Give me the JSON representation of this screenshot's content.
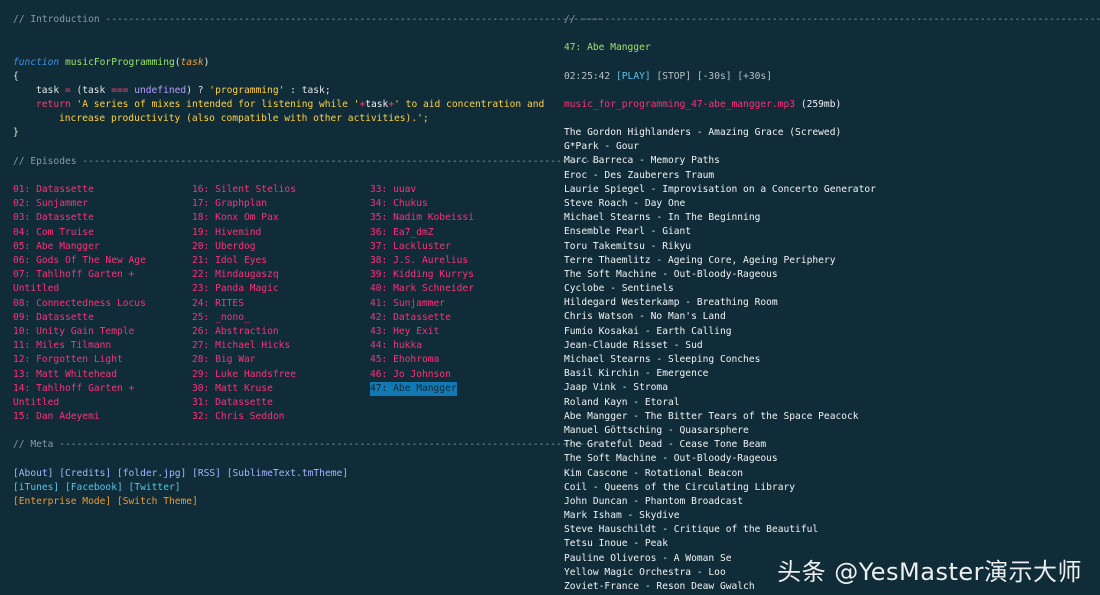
{
  "intro": {
    "header": "// Introduction --------------------------------------------------------------------------------------",
    "kw_function": "function",
    "fn_name": "musicForProgramming",
    "paren_open": "(",
    "param": "task",
    "paren_close": ")",
    "brace_open": "{",
    "l3_a": "task",
    "l3_b": " = ",
    "l3_c": "(task ",
    "l3_d": "===",
    "l3_e": " ",
    "l3_f": "undefined",
    "l3_g": ") ? ",
    "l3_h": "'programming'",
    "l3_i": " : task;",
    "l4_kw": "return",
    "l4_str1": " 'A series of mixes intended for listening while '",
    "l4_op1": "+",
    "l4_task": "task",
    "l4_op2": "+",
    "l4_str2": "' to aid concentration and",
    "l5": "increase productivity (also compatible with other activities).';",
    "brace_close": "}"
  },
  "episodes": {
    "header": "// Episodes ------------------------------------------------------------------------------------------",
    "col1": [
      "01: Datassette",
      "02: Sunjammer",
      "03: Datassette",
      "04: Com Truise",
      "05: Abe Mangger",
      "06: Gods Of The New Age",
      "07: Tahlhoff Garten +",
      "Untitled",
      "08: Connectedness Locus",
      "09: Datassette",
      "10: Unity Gain Temple",
      "11: Miles Tilmann",
      "12: Forgotten Light",
      "13: Matt Whitehead",
      "14: Tahlhoff Garten +",
      "Untitled",
      "15: Dan Adeyemi"
    ],
    "col2": [
      "16: Silent Stelios",
      "17: Graphplan",
      "18: Konx Om Pax",
      "19: Hivemind",
      "20: Uberdog",
      "21: Idol Eyes",
      "22: Mindaugaszq",
      "23: Panda Magic",
      "24: RITES",
      "25: _nono_",
      "26: Abstraction",
      "27: Michael Hicks",
      "28: Big War",
      "29: Luke Handsfree",
      "30: Matt Kruse",
      "31: Datassette",
      "32: Chris Seddon"
    ],
    "col3": [
      "33: uuav",
      "34: Chukus",
      "35: Nadim Kobeissi",
      "36: Ea7_dmZ",
      "37: Lackluster",
      "38: J.S. Aurelius",
      "39: Kidding Kurrys",
      "40: Mark Schneider",
      "41: Sunjammer",
      "42: Datassette",
      "43: Hey Exit",
      "44: hukka",
      "45: Ehohroma",
      "46: Jo Johnson",
      "47: Abe Mangger"
    ]
  },
  "meta": {
    "header": "// Meta ----------------------------------------------------------------------------------------------",
    "about": "[About]",
    "credits": "[Credits]",
    "folder": "[folder.jpg]",
    "rss": "[RSS]",
    "sublime": "[SublimeText.tmTheme]",
    "itunes": "[iTunes]",
    "facebook": "[Facebook]",
    "twitter": "[Twitter]",
    "enterprise": "[Enterprise Mode]",
    "switch": "[Switch Theme]"
  },
  "player": {
    "header": "// --------------------------------------------------------------------------------------------",
    "title": "47: Abe Mangger",
    "time": "02:25:42",
    "play": "[PLAY]",
    "stop": "[STOP]",
    "back": "[-30s]",
    "fwd": "[+30s]",
    "file": "music_for_programming_47-abe_mangger.mp3",
    "size": "(259mb)"
  },
  "tracklist": [
    "The Gordon Highlanders - Amazing Grace (Screwed)",
    "G*Park - Gour",
    "Marc Barreca - Memory Paths",
    "Eroc - Des Zauberers Traum",
    "Laurie Spiegel - Improvisation on a Concerto Generator",
    "Steve Roach - Day One",
    "Michael Stearns - In The Beginning",
    "Ensemble Pearl - Giant",
    "Toru Takemitsu - Rikyu",
    "Terre Thaemlitz - Ageing Core, Ageing Periphery",
    "The Soft Machine - Out-Bloody-Rageous",
    "Cyclobe - Sentinels",
    "Hildegard Westerkamp - Breathing Room",
    "Chris Watson - No Man's Land",
    "Fumio Kosakai - Earth Calling",
    "Jean-Claude Risset - Sud",
    "Michael Stearns - Sleeping Conches",
    "Basil Kirchin - Emergence",
    "Jaap Vink - Stroma",
    "Roland Kayn - Etoral",
    "Abe Mangger - The Bitter Tears of the Space Peacock",
    "Manuel Göttsching - Quasarsphere",
    "The Grateful Dead - Cease Tone Beam",
    "The Soft Machine - Out-Bloody-Rageous",
    "Kim Cascone - Rotational Beacon",
    "Coil - Queens of the Circulating Library",
    "John Duncan - Phantom Broadcast",
    "Mark Isham - Skydive",
    "Steve Hauschildt - Critique of the Beautiful",
    "Tetsu Inoue - Peak",
    "Pauline Oliveros - A Woman Se",
    "Yellow Magic Orchestra - Loo",
    "Zoviet-France - Reson Deaw Gwalch"
  ],
  "watermark": "头条 @YesMaster演示大师"
}
